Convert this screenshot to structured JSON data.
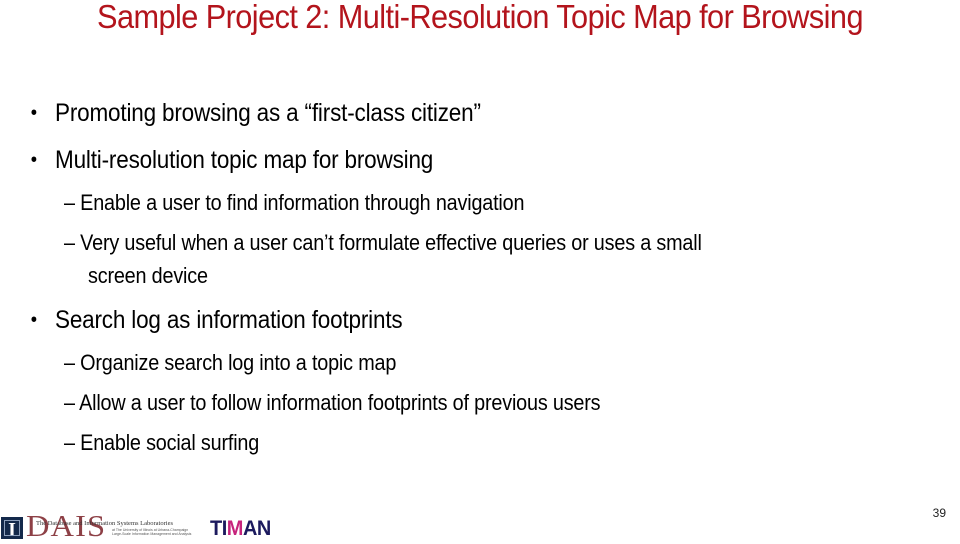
{
  "slide": {
    "title": "Sample Project 2: Multi-Resolution Topic Map for Browsing",
    "page_number": "39",
    "colors": {
      "title": "#b3141c",
      "body": "#000000"
    }
  },
  "bullets": [
    {
      "marker": "•",
      "text": "Promoting browsing as a “first-class citizen”",
      "sub": []
    },
    {
      "marker": "•",
      "text": "Multi-resolution topic map for browsing",
      "sub": [
        {
          "marker": "–",
          "text": "Enable a user to find information through navigation"
        },
        {
          "marker": "–",
          "text": "Very useful when a user can’t formulate effective queries or uses a small",
          "continuation": "screen device"
        }
      ]
    },
    {
      "marker": "•",
      "text": "Search log as information footprints",
      "sub": [
        {
          "marker": "–",
          "text": "Organize search log into a topic map"
        },
        {
          "marker": "–",
          "text": "Allow a user to follow information footprints of previous users"
        },
        {
          "marker": "–",
          "text": "Enable social surfing"
        }
      ]
    }
  ],
  "footer": {
    "illinois_logo": "I",
    "dais_logo": {
      "word": "DAIS",
      "tagline": "The Database and Information Systems Laboratories",
      "subline_1": "at The University of Illinois at Urbana-Champaign",
      "subline_2": "Large-Scale Information Management and Analysis"
    },
    "timan_logo": {
      "prefix": "TI",
      "highlight": "M",
      "suffix": "AN"
    }
  }
}
